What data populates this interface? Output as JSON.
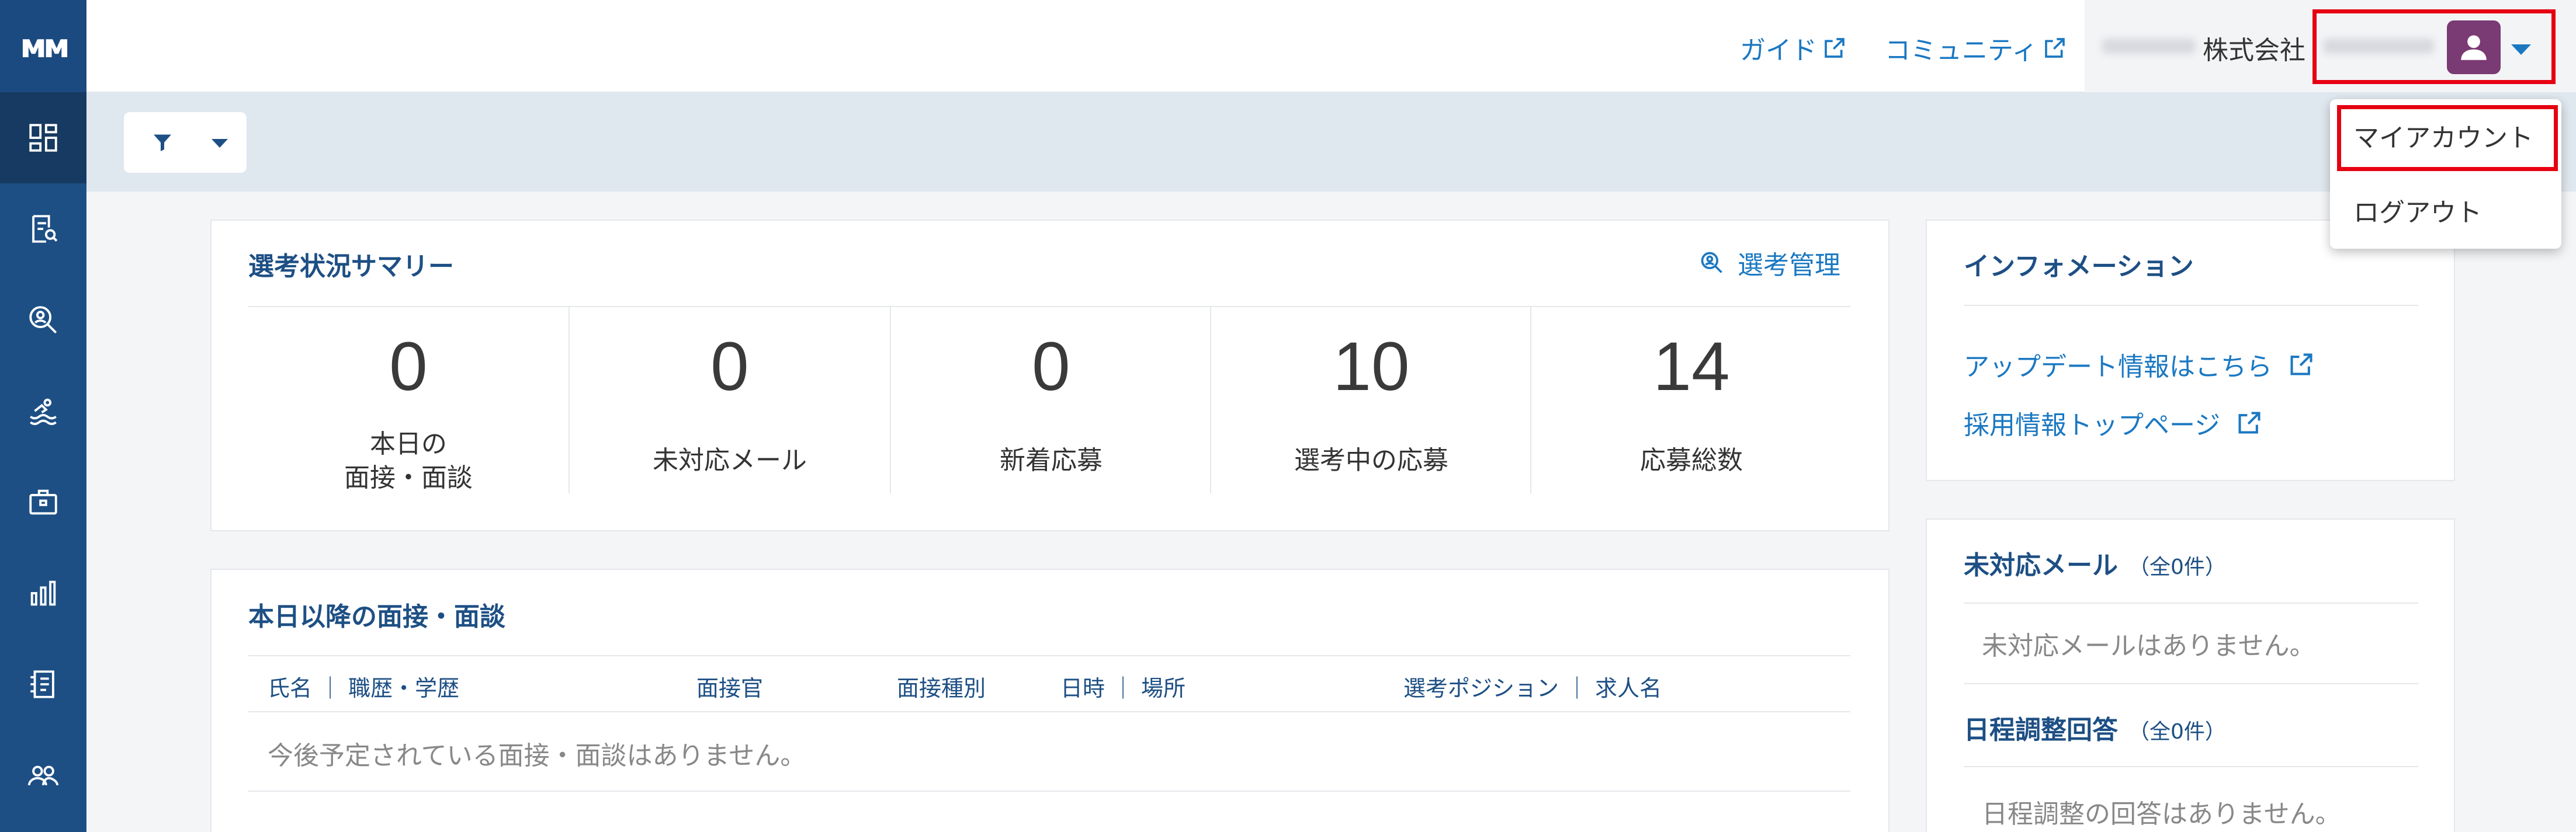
{
  "header": {
    "guide_label": "ガイド",
    "community_label": "コミュニティ",
    "company_suffix": "株式会社"
  },
  "user_menu": {
    "items": [
      "マイアカウント",
      "ログアウト"
    ]
  },
  "summary": {
    "title": "選考状況サマリー",
    "manage_label": "選考管理",
    "stats": [
      {
        "value": "0",
        "label_line1": "本日の",
        "label_line2": "面接・面談"
      },
      {
        "value": "0",
        "label_line1": "未対応メール",
        "label_line2": ""
      },
      {
        "value": "0",
        "label_line1": "新着応募",
        "label_line2": ""
      },
      {
        "value": "10",
        "label_line1": "選考中の応募",
        "label_line2": ""
      },
      {
        "value": "14",
        "label_line1": "応募総数",
        "label_line2": ""
      }
    ]
  },
  "interviews": {
    "title": "本日以降の面接・面談",
    "columns": [
      "氏名 ｜ 職歴・学歴",
      "面接官",
      "面接種別",
      "日時 ｜ 場所",
      "選考ポジション ｜ 求人名"
    ],
    "empty_text": "今後予定されている面接・面談はありません。"
  },
  "info": {
    "title": "インフォメーション",
    "links": [
      "アップデート情報はこちら",
      "採用情報トップページ"
    ]
  },
  "pending": {
    "mail_title": "未対応メール",
    "mail_count": "（全0件）",
    "mail_empty": "未対応メールはありません。",
    "schedule_title": "日程調整回答",
    "schedule_count": "（全0件）",
    "schedule_empty": "日程調整の回答はありません。"
  },
  "colors": {
    "sidebar": "#1d4f84",
    "link": "#1a78c2",
    "highlight": "#e60012",
    "avatar": "#7a3a73"
  }
}
